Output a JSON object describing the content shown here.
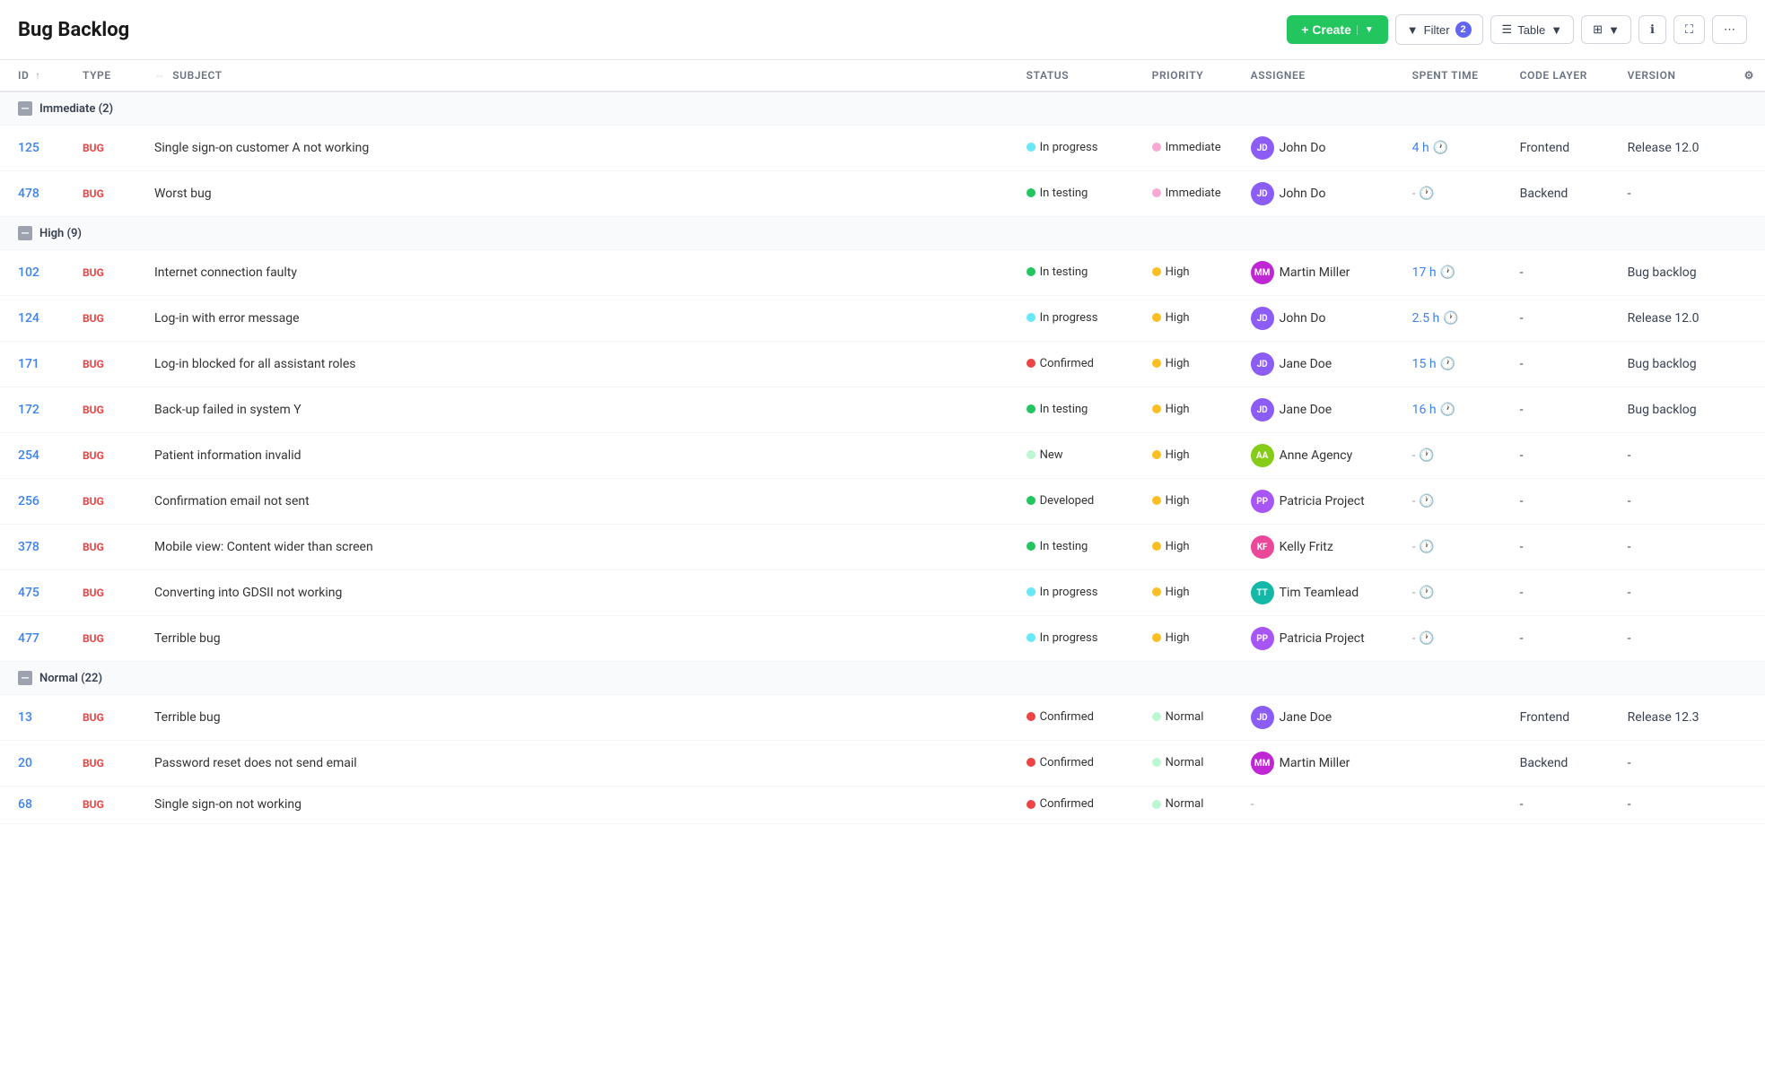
{
  "header": {
    "title": "Bug Backlog",
    "create_label": "+ Create",
    "filter_label": "Filter",
    "filter_count": "2",
    "table_label": "Table",
    "more_label": "⋯"
  },
  "columns": [
    {
      "key": "id",
      "label": "ID",
      "sortable": true
    },
    {
      "key": "type",
      "label": "TYPE",
      "sortable": false
    },
    {
      "key": "subject",
      "label": "SUBJECT",
      "sortable": false,
      "resizable": true
    },
    {
      "key": "status",
      "label": "STATUS",
      "sortable": false
    },
    {
      "key": "priority",
      "label": "PRIORITY",
      "sortable": false
    },
    {
      "key": "assignee",
      "label": "ASSIGNEE",
      "sortable": false
    },
    {
      "key": "spent_time",
      "label": "SPENT TIME",
      "sortable": false
    },
    {
      "key": "code_layer",
      "label": "CODE LAYER",
      "sortable": false
    },
    {
      "key": "version",
      "label": "VERSION",
      "sortable": false
    }
  ],
  "groups": [
    {
      "name": "Immediate",
      "count": 2,
      "rows": [
        {
          "id": "125",
          "type": "BUG",
          "subject": "Single sign-on customer A not working",
          "status": "In progress",
          "status_color": "#67e8f9",
          "priority": "Immediate",
          "priority_color": "#f9a8d4",
          "assignee": "John Do",
          "assignee_initials": "JD",
          "assignee_color": "#8b5cf6",
          "spent_time": "4 h",
          "code_layer": "Frontend",
          "version": "Release 12.0"
        },
        {
          "id": "478",
          "type": "BUG",
          "subject": "Worst bug",
          "status": "In testing",
          "status_color": "#22c55e",
          "priority": "Immediate",
          "priority_color": "#f9a8d4",
          "assignee": "John Do",
          "assignee_initials": "JD",
          "assignee_color": "#8b5cf6",
          "spent_time": "-",
          "code_layer": "Backend",
          "version": "-"
        }
      ]
    },
    {
      "name": "High",
      "count": 9,
      "rows": [
        {
          "id": "102",
          "type": "BUG",
          "subject": "Internet connection faulty",
          "status": "In testing",
          "status_color": "#22c55e",
          "priority": "High",
          "priority_color": "#fbbf24",
          "assignee": "Martin Miller",
          "assignee_initials": "MM",
          "assignee_color": "#c026d3",
          "spent_time": "17 h",
          "code_layer": "-",
          "version": "Bug backlog"
        },
        {
          "id": "124",
          "type": "BUG",
          "subject": "Log-in with error message",
          "status": "In progress",
          "status_color": "#67e8f9",
          "priority": "High",
          "priority_color": "#fbbf24",
          "assignee": "John Do",
          "assignee_initials": "JD",
          "assignee_color": "#8b5cf6",
          "spent_time": "2.5 h",
          "code_layer": "-",
          "version": "Release 12.0"
        },
        {
          "id": "171",
          "type": "BUG",
          "subject": "Log-in blocked for all assistant roles",
          "status": "Confirmed",
          "status_color": "#ef4444",
          "priority": "High",
          "priority_color": "#fbbf24",
          "assignee": "Jane Doe",
          "assignee_initials": "JD",
          "assignee_color": "#8b5cf6",
          "spent_time": "15 h",
          "code_layer": "-",
          "version": "Bug backlog"
        },
        {
          "id": "172",
          "type": "BUG",
          "subject": "Back-up failed in system Y",
          "status": "In testing",
          "status_color": "#22c55e",
          "priority": "High",
          "priority_color": "#fbbf24",
          "assignee": "Jane Doe",
          "assignee_initials": "JD",
          "assignee_color": "#8b5cf6",
          "spent_time": "16 h",
          "code_layer": "-",
          "version": "Bug backlog"
        },
        {
          "id": "254",
          "type": "BUG",
          "subject": "Patient information invalid",
          "status": "New",
          "status_color": "#bbf7d0",
          "priority": "High",
          "priority_color": "#fbbf24",
          "assignee": "Anne Agency",
          "assignee_initials": "AA",
          "assignee_color": "#84cc16",
          "spent_time": "-",
          "code_layer": "-",
          "version": "-"
        },
        {
          "id": "256",
          "type": "BUG",
          "subject": "Confirmation email not sent",
          "status": "Developed",
          "status_color": "#22c55e",
          "priority": "High",
          "priority_color": "#fbbf24",
          "assignee": "Patricia Project",
          "assignee_initials": "PP",
          "assignee_color": "#a855f7",
          "spent_time": "-",
          "code_layer": "-",
          "version": "-"
        },
        {
          "id": "378",
          "type": "BUG",
          "subject": "Mobile view: Content wider than screen",
          "status": "In testing",
          "status_color": "#22c55e",
          "priority": "High",
          "priority_color": "#fbbf24",
          "assignee": "Kelly Fritz",
          "assignee_initials": "KF",
          "assignee_color": "#ec4899",
          "spent_time": "-",
          "code_layer": "-",
          "version": "-"
        },
        {
          "id": "475",
          "type": "BUG",
          "subject": "Converting into GDSII not working",
          "status": "In progress",
          "status_color": "#67e8f9",
          "priority": "High",
          "priority_color": "#fbbf24",
          "assignee": "Tim Teamlead",
          "assignee_initials": "TT",
          "assignee_color": "#14b8a6",
          "spent_time": "-",
          "code_layer": "-",
          "version": "-"
        },
        {
          "id": "477",
          "type": "BUG",
          "subject": "Terrible bug",
          "status": "In progress",
          "status_color": "#67e8f9",
          "priority": "High",
          "priority_color": "#fbbf24",
          "assignee": "Patricia Project",
          "assignee_initials": "PP",
          "assignee_color": "#a855f7",
          "spent_time": "-",
          "code_layer": "-",
          "version": "-"
        }
      ]
    },
    {
      "name": "Normal",
      "count": 22,
      "rows": [
        {
          "id": "13",
          "type": "BUG",
          "subject": "Terrible bug",
          "status": "Confirmed",
          "status_color": "#ef4444",
          "priority": "Normal",
          "priority_color": "#bbf7d0",
          "assignee": "Jane Doe",
          "assignee_initials": "JD",
          "assignee_color": "#8b5cf6",
          "spent_time": "",
          "code_layer": "Frontend",
          "version": "Release 12.3"
        },
        {
          "id": "20",
          "type": "BUG",
          "subject": "Password reset does not send email",
          "status": "Confirmed",
          "status_color": "#ef4444",
          "priority": "Normal",
          "priority_color": "#bbf7d0",
          "assignee": "Martin Miller",
          "assignee_initials": "MM",
          "assignee_color": "#c026d3",
          "spent_time": "",
          "code_layer": "Backend",
          "version": "-"
        },
        {
          "id": "68",
          "type": "BUG",
          "subject": "Single sign-on not working",
          "status": "Confirmed",
          "status_color": "#ef4444",
          "priority": "Normal",
          "priority_color": "#bbf7d0",
          "assignee": "-",
          "assignee_initials": "",
          "assignee_color": "",
          "spent_time": "",
          "code_layer": "-",
          "version": "-"
        }
      ]
    }
  ]
}
